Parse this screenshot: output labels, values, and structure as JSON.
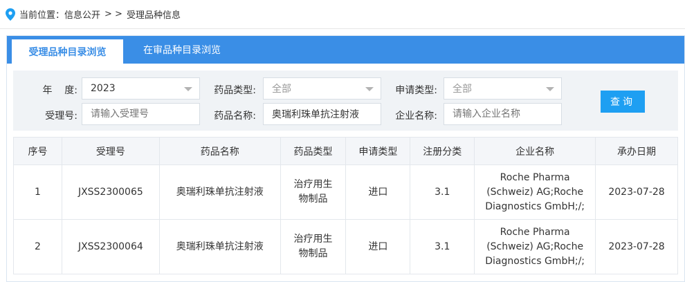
{
  "breadcrumb": {
    "prefix": "当前位置：",
    "link": "信息公开",
    "sep": "> >",
    "current": "受理品种信息"
  },
  "tabs": [
    {
      "label": "受理品种目录浏览",
      "active": true
    },
    {
      "label": "在审品种目录浏览",
      "active": false
    }
  ],
  "filters": {
    "year_label": "年    度:",
    "year_value": "2023",
    "drug_type_label": "药品类型:",
    "drug_type_value": "全部",
    "apply_type_label": "申请类型:",
    "apply_type_value": "全部",
    "accept_no_label": "受理号:",
    "accept_no_placeholder": "请输入受理号",
    "drug_name_label": "药品名称:",
    "drug_name_value": "奥瑞利珠单抗注射液",
    "company_label": "企业名称:",
    "company_placeholder": "请输入企业名称",
    "query_button": "查询"
  },
  "table": {
    "headers": [
      "序号",
      "受理号",
      "药品名称",
      "药品类型",
      "申请类型",
      "注册分类",
      "企业名称",
      "承办日期"
    ],
    "rows": [
      {
        "index": "1",
        "accept_no": "JXSS2300065",
        "drug_name": "奥瑞利珠单抗注射液",
        "drug_type": [
          "治疗用生",
          "物制品"
        ],
        "apply_type": "进口",
        "reg_class": "3.1",
        "company": [
          "Roche Pharma",
          "(Schweiz) AG;Roche",
          "Diagnostics GmbH;/;"
        ],
        "date": "2023-07-28"
      },
      {
        "index": "2",
        "accept_no": "JXSS2300064",
        "drug_name": "奥瑞利珠单抗注射液",
        "drug_type": [
          "治疗用生",
          "物制品"
        ],
        "apply_type": "进口",
        "reg_class": "3.1",
        "company": [
          "Roche Pharma",
          "(Schweiz) AG;Roche",
          "Diagnostics GmbH;/;"
        ],
        "date": "2023-07-28"
      }
    ]
  },
  "colors": {
    "accent": "#3a8ee6",
    "button": "#1e9ff2",
    "pin": "#1e9ff2"
  }
}
